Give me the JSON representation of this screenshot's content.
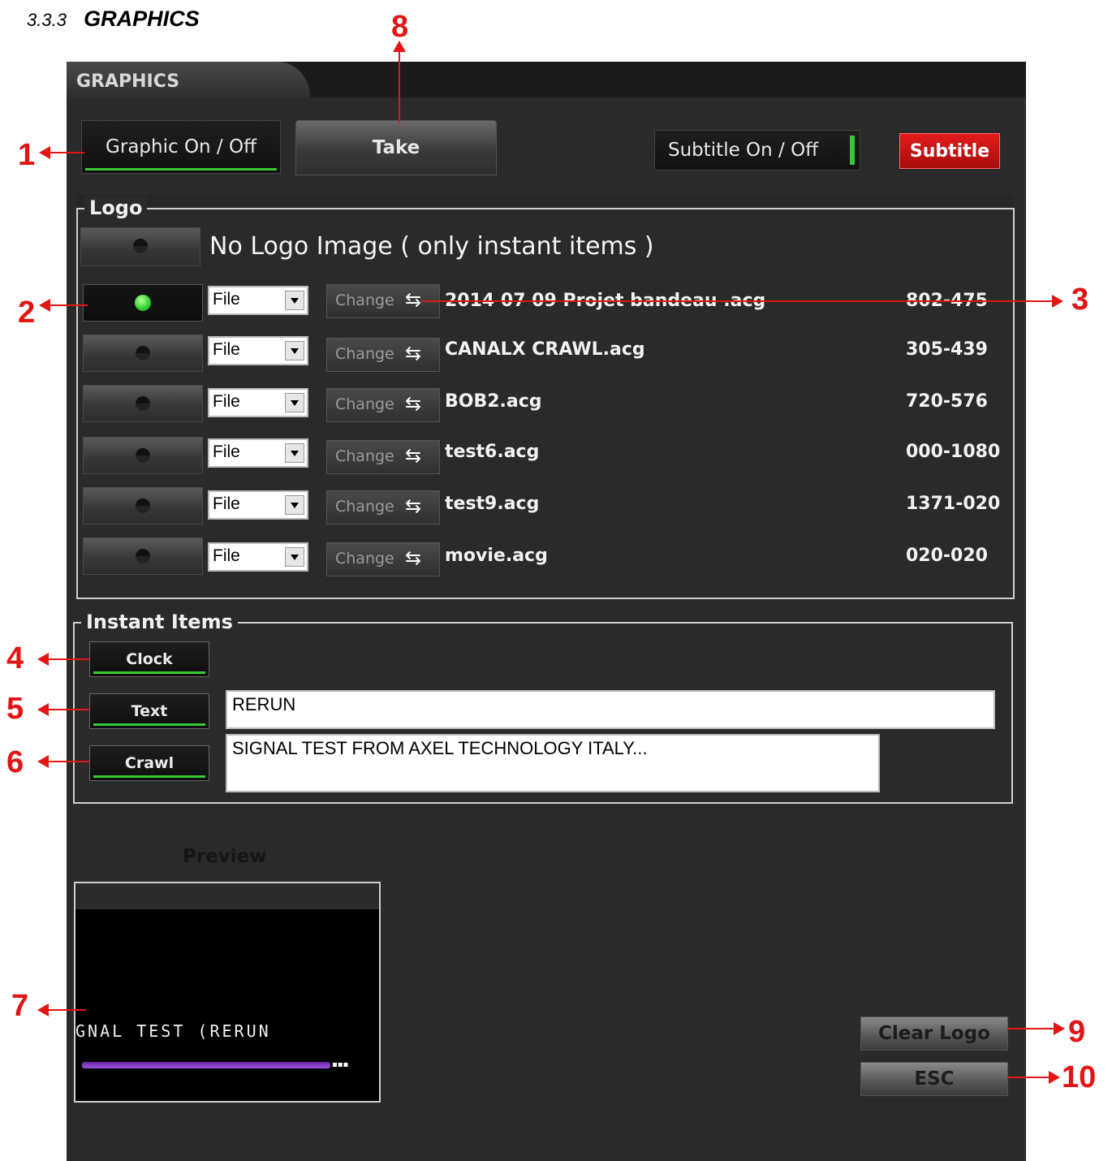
{
  "doc": {
    "section_number": "3.3.3",
    "section_title": "GRAPHICS"
  },
  "window": {
    "tab": "GRAPHICS"
  },
  "toolbar": {
    "graphic_toggle": "Graphic On / Off",
    "take": "Take",
    "subtitle_toggle": "Subtitle On / Off",
    "subtitle": "Subtitle"
  },
  "logo": {
    "group_title": "Logo",
    "no_logo_label": "No Logo Image ( only instant items )",
    "rows": [
      {
        "source": "File",
        "change": "Change",
        "file": "2014 07 09 Projet bandeau .acg",
        "coords": "802-475",
        "active": true
      },
      {
        "source": "File",
        "change": "Change",
        "file": "CANALX CRAWL.acg",
        "coords": "305-439",
        "active": false
      },
      {
        "source": "File",
        "change": "Change",
        "file": "BOB2.acg",
        "coords": "720-576",
        "active": false
      },
      {
        "source": "File",
        "change": "Change",
        "file": "test6.acg",
        "coords": "000-1080",
        "active": false
      },
      {
        "source": "File",
        "change": "Change",
        "file": "test9.acg",
        "coords": "1371-020",
        "active": false
      },
      {
        "source": "File",
        "change": "Change",
        "file": "movie.acg",
        "coords": "020-020",
        "active": false
      }
    ]
  },
  "instant": {
    "group_title": "Instant Items",
    "clock": "Clock",
    "text": "Text",
    "text_value": "RERUN",
    "crawl": "Crawl",
    "crawl_value": "SIGNAL TEST FROM AXEL TECHNOLOGY ITALY..."
  },
  "preview": {
    "label": "Preview",
    "ticker_text": "GNAL TEST (RERUN"
  },
  "footer": {
    "clear_logo": "Clear Logo",
    "esc": "ESC"
  },
  "callouts": [
    "1",
    "2",
    "3",
    "4",
    "5",
    "6",
    "7",
    "8",
    "9",
    "10"
  ],
  "colors": {
    "accent_green": "#35c935",
    "subtitle_red": "#d01010",
    "callout_red": "#e21414"
  }
}
